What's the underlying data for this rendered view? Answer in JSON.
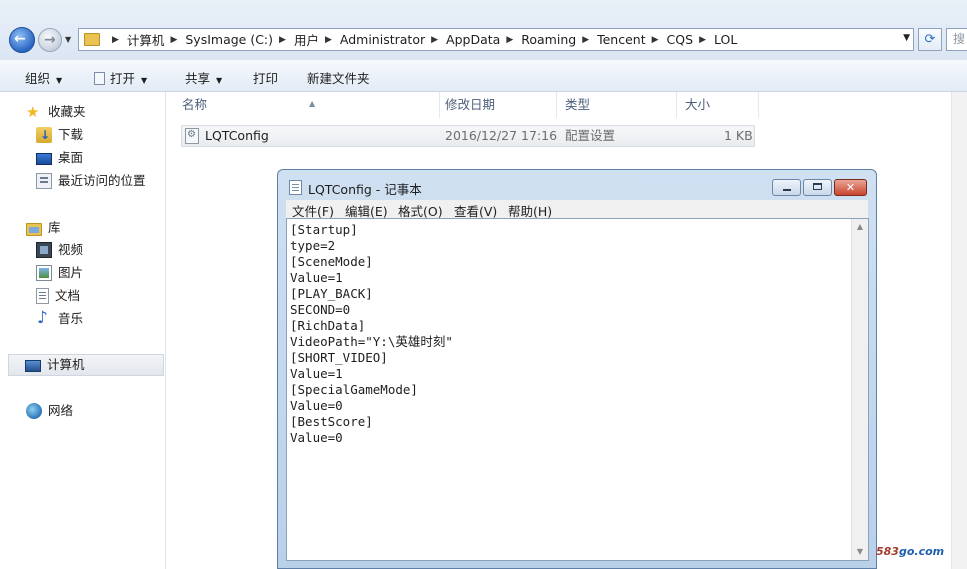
{
  "address": {
    "crumbs": [
      "计算机",
      "SysImage (C:)",
      "用户",
      "Administrator",
      "AppData",
      "Roaming",
      "Tencent",
      "CQS",
      "LOL"
    ],
    "search_placeholder": "搜"
  },
  "toolbar": {
    "organize": "组织",
    "open": "打开",
    "share": "共享",
    "print": "打印",
    "new_folder": "新建文件夹"
  },
  "navpane": {
    "favorites": "收藏夹",
    "downloads": "下载",
    "desktop": "桌面",
    "recent": "最近访问的位置",
    "libraries": "库",
    "videos": "视频",
    "pictures": "图片",
    "documents": "文档",
    "music": "音乐",
    "computer": "计算机",
    "network": "网络"
  },
  "filelist": {
    "headers": {
      "name": "名称",
      "modified": "修改日期",
      "type": "类型",
      "size": "大小"
    },
    "rows": [
      {
        "name": "LQTConfig",
        "modified": "2016/12/27 17:16",
        "type": "配置设置",
        "size": "1 KB"
      }
    ]
  },
  "notepad": {
    "title": "LQTConfig - 记事本",
    "menus": [
      "文件(F)",
      "编辑(E)",
      "格式(O)",
      "查看(V)",
      "帮助(H)"
    ],
    "content": "[Startup]\ntype=2\n[SceneMode]\nValue=1\n[PLAY_BACK]\nSECOND=0\n[RichData]\nVideoPath=\"Y:\\英雄时刻\"\n[SHORT_VIDEO]\nValue=1\n[SpecialGameMode]\nValue=0\n[BestScore]\nValue=0"
  },
  "watermark": {
    "red": "583",
    "blue": "go.com"
  },
  "colors": {
    "accent": "#2a66c4",
    "close": "#c9452e",
    "toolbar_bg": "#e3ebf6"
  }
}
